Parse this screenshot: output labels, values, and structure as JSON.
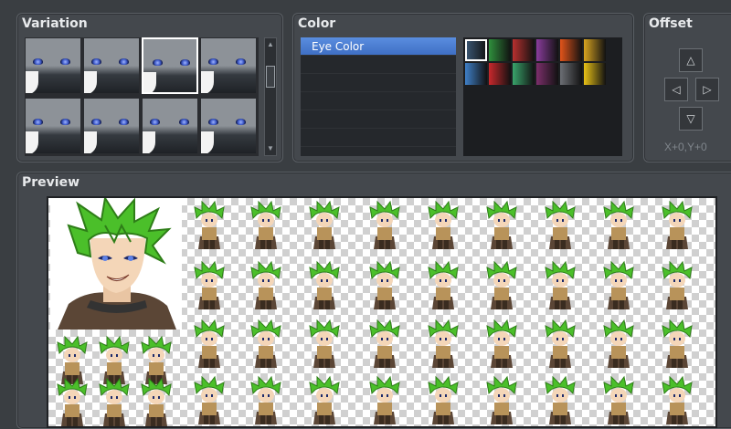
{
  "panels": {
    "variation": {
      "title": "Variation",
      "selected_index": 2
    },
    "color": {
      "title": "Color",
      "list": [
        {
          "label": "Eye Color",
          "active": true
        },
        {
          "label": "",
          "active": false
        },
        {
          "label": "",
          "active": false
        },
        {
          "label": "",
          "active": false
        },
        {
          "label": "",
          "active": false
        },
        {
          "label": "",
          "active": false
        }
      ],
      "palette_top": [
        "#3c5a78",
        "#2f8f3c",
        "#b7302f",
        "#8a3c9c",
        "#e2541a",
        "#d7a320"
      ],
      "palette_bottom": [
        "#3f80c8",
        "#c8282c",
        "#39a46b",
        "#7c2f6b",
        "#6c6f75",
        "#e8c116"
      ],
      "selected_swatch": 0
    },
    "offset": {
      "title": "Offset",
      "label": "X+0,Y+0"
    },
    "preview": {
      "title": "Preview"
    }
  },
  "icons": {
    "scroll_up": "▲",
    "scroll_down": "▼",
    "offset_up": "△",
    "offset_down": "▽",
    "offset_left": "◁",
    "offset_right": "▷"
  },
  "colors": {
    "hair": "#4bbf2a",
    "hair_dark": "#2e7d18",
    "skin": "#f4d6b8",
    "armor": "#b8935a",
    "cloak": "#5b4636",
    "selection": "#4f84d6"
  }
}
